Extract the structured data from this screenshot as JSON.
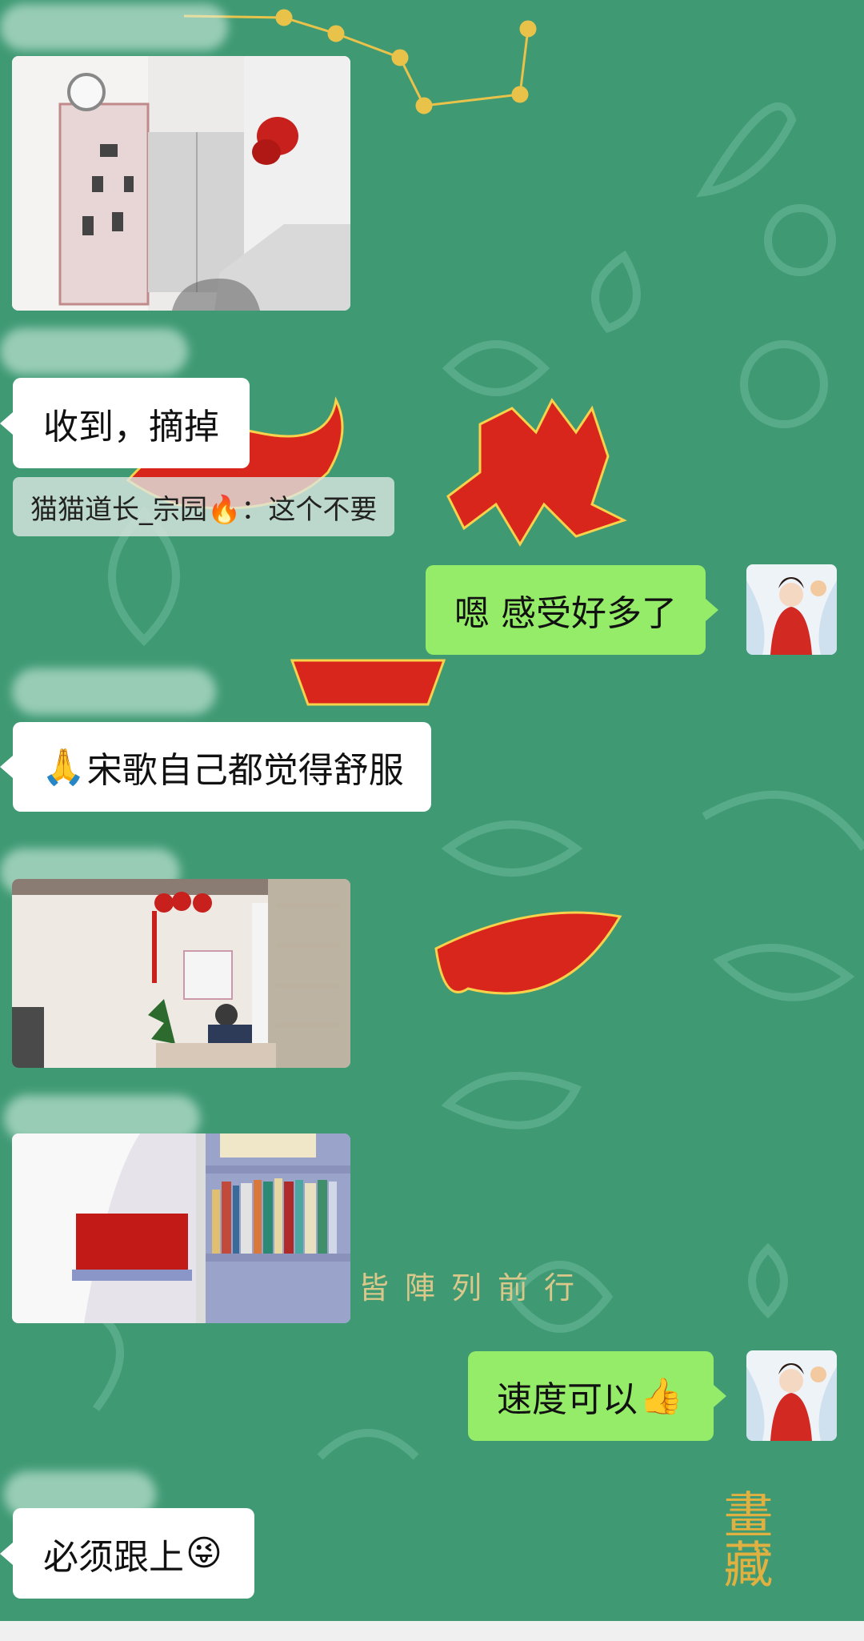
{
  "messages": {
    "m1_text": "收到，摘掉",
    "quote_text": "猫猫道长_宗园🔥：这个不要",
    "m2_text": "嗯 感受好多了",
    "m3_text": "宋歌自己都觉得舒服",
    "m4_text": "速度可以",
    "m5_text": "必须跟上"
  },
  "icons": {
    "prayer": "🙏",
    "thumbs_up": "👍",
    "wink_tongue": "😜"
  },
  "background": {
    "caption": "皆陣列前行",
    "seal_text": "畫藏"
  },
  "colors": {
    "chat_bg": "#3f9a74",
    "incoming_bubble": "#ffffff",
    "outgoing_bubble": "#95ec69",
    "accent_red": "#d9261c",
    "gold": "#e9c24a"
  }
}
